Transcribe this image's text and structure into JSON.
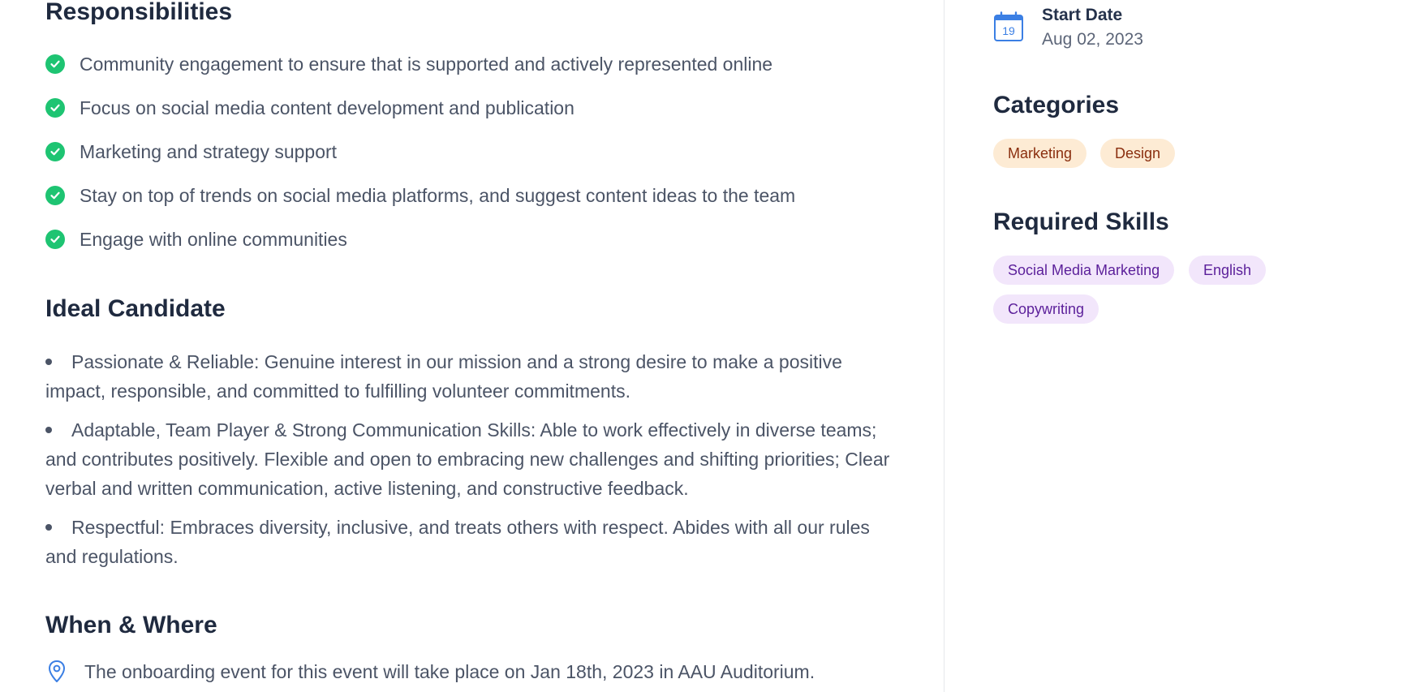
{
  "responsibilities": {
    "title": "Responsibilities",
    "items": [
      "Community engagement to ensure that is supported and actively represented online",
      "Focus on social media content development and publication",
      "Marketing and strategy support",
      "Stay on top of trends on social media platforms, and suggest content ideas to the team",
      "Engage with online communities"
    ]
  },
  "ideal_candidate": {
    "title": "Ideal Candidate",
    "items": [
      "Passionate & Reliable: Genuine interest in our mission and a strong desire to make a positive impact, responsible, and committed to fulfilling volunteer commitments.",
      "Adaptable, Team Player & Strong Communication Skills: Able to work effectively in diverse teams; and contributes positively. Flexible and open to embracing new challenges and shifting priorities; Clear verbal and written communication, active listening, and constructive feedback.",
      "Respectful: Embraces diversity, inclusive, and treats others with respect. Abides with all our rules and regulations."
    ]
  },
  "when_where": {
    "title": "When & Where",
    "text": "The onboarding event for this event will take place on Jan 18th, 2023 in AAU Auditorium.",
    "icon": "location-pin-icon"
  },
  "sidebar": {
    "start_date": {
      "label": "Start Date",
      "value": "Aug 02, 2023",
      "icon_day": "19",
      "icon": "calendar-icon"
    },
    "categories": {
      "title": "Categories",
      "tags": [
        "Marketing",
        "Design"
      ]
    },
    "required_skills": {
      "title": "Required Skills",
      "tags": [
        "Social Media Marketing",
        "English",
        "Copywriting"
      ]
    }
  },
  "colors": {
    "check": "#1ec472",
    "accent_blue": "#3b7fe4",
    "category_bg": "#fdebd4",
    "category_text": "#8a2e0e",
    "skill_bg": "#f2e6fb",
    "skill_text": "#5b1f9a",
    "heading": "#1f2a3f",
    "body_text": "#4b5466"
  }
}
